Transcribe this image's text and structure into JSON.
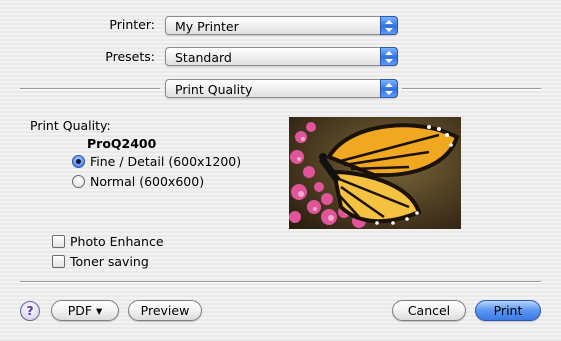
{
  "printer": {
    "label": "Printer:",
    "value": "My Printer"
  },
  "presets": {
    "label": "Presets:",
    "value": "Standard"
  },
  "panel": {
    "value": "Print Quality"
  },
  "quality": {
    "heading": "Print Quality:",
    "model": "ProQ2400",
    "options": [
      {
        "label": "Fine / Detail (600x1200)",
        "selected": true
      },
      {
        "label": "Normal (600x600)",
        "selected": false
      }
    ]
  },
  "options": {
    "photo_enhance": {
      "label": "Photo Enhance",
      "checked": false
    },
    "toner_saving": {
      "label": "Toner saving",
      "checked": false
    }
  },
  "buttons": {
    "help": "?",
    "pdf": "PDF ▾",
    "preview": "Preview",
    "cancel": "Cancel",
    "print": "Print"
  },
  "colors": {
    "accent": "#3b7ae6",
    "help_glyph": "#5a3aa8"
  },
  "preview_image": "butterfly"
}
